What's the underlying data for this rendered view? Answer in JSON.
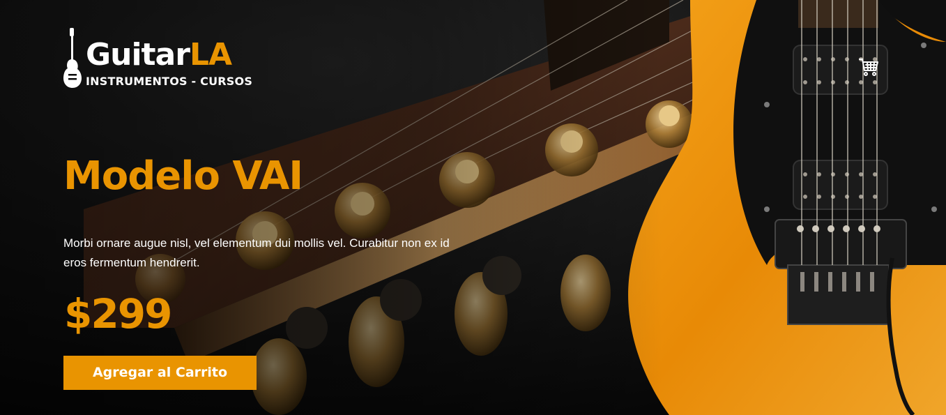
{
  "header": {
    "logo": {
      "brand_main": "Guitar",
      "brand_accent": "LA",
      "tagline": "INSTRUMENTOS - CURSOS",
      "icon": "guitar-icon"
    },
    "cart": {
      "icon": "cart-icon"
    }
  },
  "featured": {
    "title": "Modelo VAI",
    "description": "Morbi ornare augue nisl, vel elementum dui mollis vel. Curabitur non ex id eros fermentum hendrerit.",
    "price": "$299",
    "add_button_label": "Agregar al Carrito"
  },
  "colors": {
    "accent": "#e99401",
    "text": "#ffffff",
    "background": "#0b0b0b"
  }
}
